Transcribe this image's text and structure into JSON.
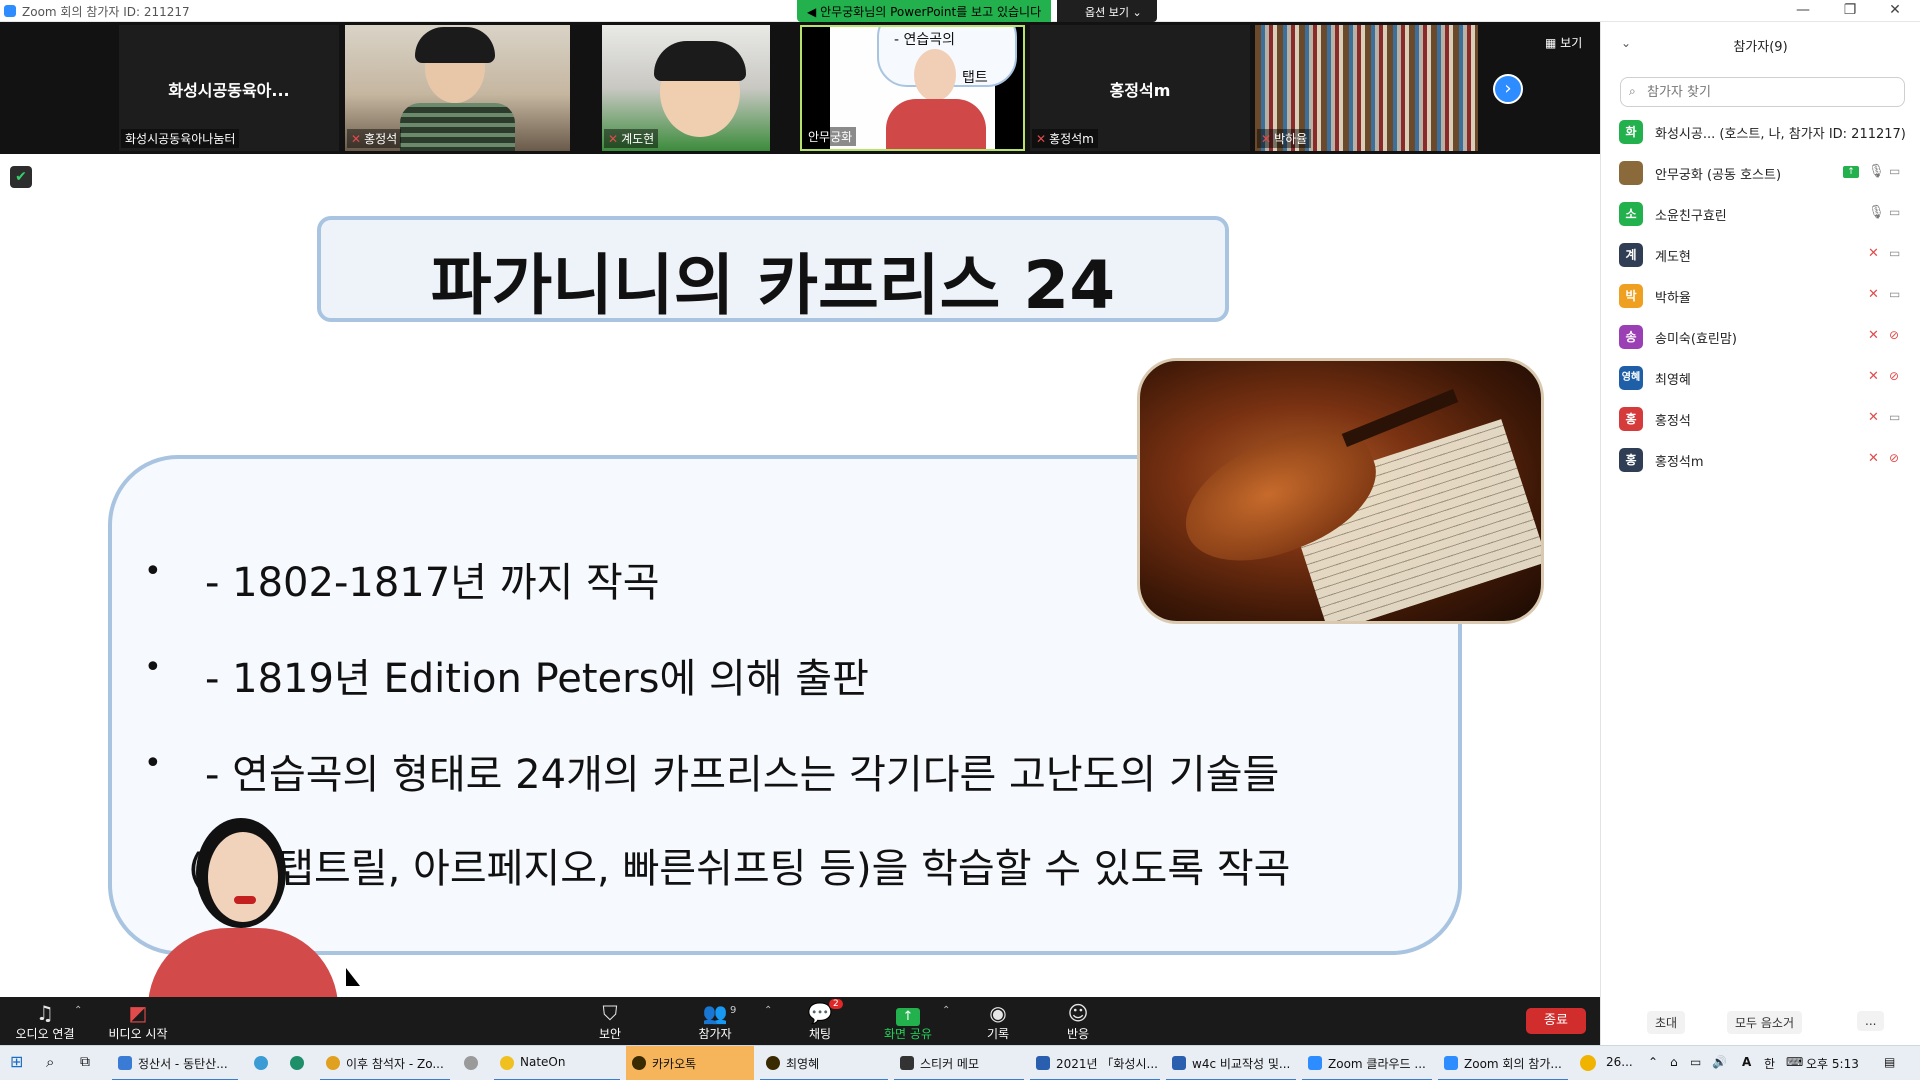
{
  "window": {
    "title": "Zoom 회의 참가자 ID: 211217",
    "share_banner": "안무궁화님의 PowerPoint를 보고 있습니다",
    "view_options": "옵션 보기"
  },
  "video_strip": {
    "view_label": "보기",
    "tiles": [
      {
        "name": "화성시공동육아나눔터",
        "center_label": "화성시공동육아...",
        "muted": false
      },
      {
        "name": "홍정석",
        "muted": true
      },
      {
        "name": "계도현",
        "muted": true
      },
      {
        "name": "안무궁화",
        "muted": false,
        "slide_text_1": "- 연습곡의",
        "slide_text_2": "탭트"
      },
      {
        "name": "홍정석m",
        "center_label": "홍정석m",
        "muted": true
      },
      {
        "name": "박하율",
        "muted": true
      }
    ]
  },
  "slide": {
    "title": "파가니니의 카프리스 24",
    "bullets": [
      "- 1802-1817년  까지  작곡",
      "- 1819년  Edition Peters에  의해  출판",
      "- 연습곡의  형태로  24개의  카프리스는  각기다른  고난도의  기술들"
    ],
    "continuation": "(트릴탭트릴, 아르페지오, 빠른쉬프팅 등)을  학습할  수  있도록  작곡"
  },
  "toolbar": {
    "audio": "오디오 연결",
    "video": "비디오 시작",
    "security": "보안",
    "participants": "참가자",
    "participants_count": "9",
    "chat": "채팅",
    "chat_badge": "2",
    "share": "화면 공유",
    "record": "기록",
    "reactions": "반응",
    "end": "종료"
  },
  "participants_panel": {
    "title": "참가자(9)",
    "search_placeholder": "참가자 찾기",
    "participants": [
      {
        "initial": "화",
        "name": "화성시공...  (호스트, 나, 참가자 ID: 211217)",
        "color": "#23b14d",
        "mic": "",
        "cam": ""
      },
      {
        "initial": "",
        "name": "안무궁화 (공동 호스트)",
        "color": "#8a6a3a",
        "mic": "on",
        "cam": "on",
        "sharing": true
      },
      {
        "initial": "소",
        "name": "소윤친구효린",
        "color": "#23b14d",
        "mic": "on",
        "cam": "on"
      },
      {
        "initial": "계",
        "name": "계도현",
        "color": "#2f3d55",
        "mic": "muted",
        "cam": "on"
      },
      {
        "initial": "박",
        "name": "박하율",
        "color": "#f0a020",
        "mic": "muted",
        "cam": "on"
      },
      {
        "initial": "송",
        "name": "송미숙(효린맘)",
        "color": "#9b3fb5",
        "mic": "muted",
        "cam": "off"
      },
      {
        "initial": "영혜",
        "name": "최영혜",
        "color": "#1f5fa8",
        "mic": "muted",
        "cam": "off"
      },
      {
        "initial": "홍",
        "name": "홍정석",
        "color": "#d63b3b",
        "mic": "muted",
        "cam": "on"
      },
      {
        "initial": "홍",
        "name": "홍정석m",
        "color": "#2f3d55",
        "mic": "muted",
        "cam": "off"
      }
    ],
    "invite": "초대",
    "mute_all": "모두 음소거",
    "more": "..."
  },
  "taskbar": {
    "items": [
      {
        "label": "정산서 - 동탄산...",
        "color": "#3a7bd5"
      },
      {
        "label": "",
        "color": "#3a9bd5"
      },
      {
        "label": "",
        "color": "#1f8f6a"
      },
      {
        "label": "이후 참석자 - Zo...",
        "color": "#e0a020"
      },
      {
        "label": "",
        "color": "#9a9a9a"
      },
      {
        "label": "NateOn",
        "color": "#f0c020"
      },
      {
        "label": "카카오톡",
        "color": "#f7d600"
      },
      {
        "label": "최영혜",
        "color": "#f7d600"
      },
      {
        "label": "스티커 메모",
        "color": "#333"
      },
      {
        "label": "2021년 「화성시...",
        "color": "#2a5fb0"
      },
      {
        "label": "w4c 비교작성 및...",
        "color": "#2a5fb0"
      },
      {
        "label": "Zoom 클라우드 ...",
        "color": "#2d8cff"
      },
      {
        "label": "Zoom 회의 참가...",
        "color": "#2d8cff"
      }
    ],
    "tray_temp": "26...",
    "ime_a": "A",
    "ime_han": "한",
    "time": "오후 5:13"
  }
}
